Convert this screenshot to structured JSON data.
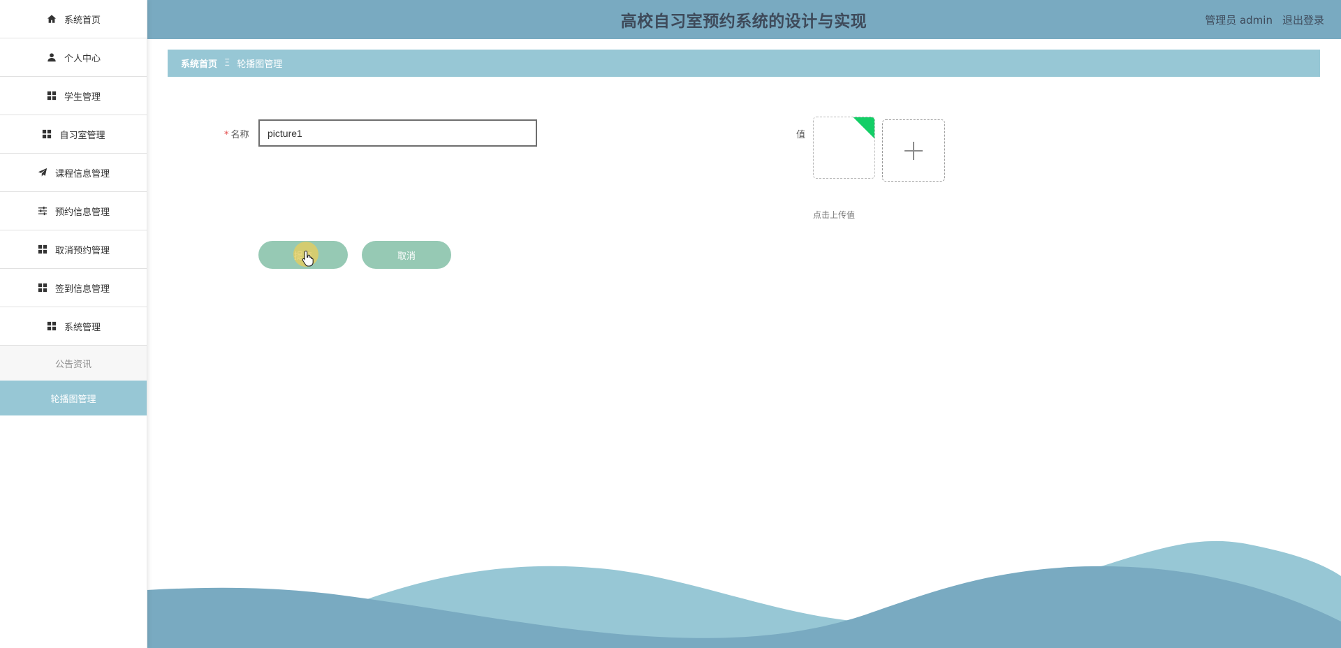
{
  "app": {
    "title": "高校自习室预约系统的设计与实现"
  },
  "header": {
    "user": "管理员 admin",
    "logout": "退出登录"
  },
  "sidebar": {
    "items": [
      {
        "label": "系统首页",
        "icon": "home-icon"
      },
      {
        "label": "个人中心",
        "icon": "user-icon"
      },
      {
        "label": "学生管理",
        "icon": "grid-icon"
      },
      {
        "label": "自习室管理",
        "icon": "grid-icon"
      },
      {
        "label": "课程信息管理",
        "icon": "send-icon"
      },
      {
        "label": "预约信息管理",
        "icon": "sliders-icon"
      },
      {
        "label": "取消预约管理",
        "icon": "grid-icon"
      },
      {
        "label": "签到信息管理",
        "icon": "grid-icon"
      },
      {
        "label": "系统管理",
        "icon": "grid-icon"
      }
    ],
    "subitems": [
      {
        "label": "公告资讯",
        "state": "normal"
      },
      {
        "label": "轮播图管理",
        "state": "active"
      }
    ]
  },
  "breadcrumb": {
    "home": "系统首页",
    "separator": "Ξ",
    "current": "轮播图管理"
  },
  "form": {
    "name_label": "名称",
    "name_required_mark": "*",
    "name_value": "picture1",
    "value_label": "值",
    "upload_hint": "点击上传值",
    "submit_label": "提交",
    "cancel_label": "取消"
  },
  "colors": {
    "header_bg": "#79aac1",
    "breadcrumb_bg": "#97c7d5",
    "active_menu_bg": "#97c7d5",
    "button_bg": "#96c9b4",
    "upload_success_corner": "#13ce66",
    "wave_light": "#97c7d5",
    "wave_dark": "#79aac1"
  }
}
